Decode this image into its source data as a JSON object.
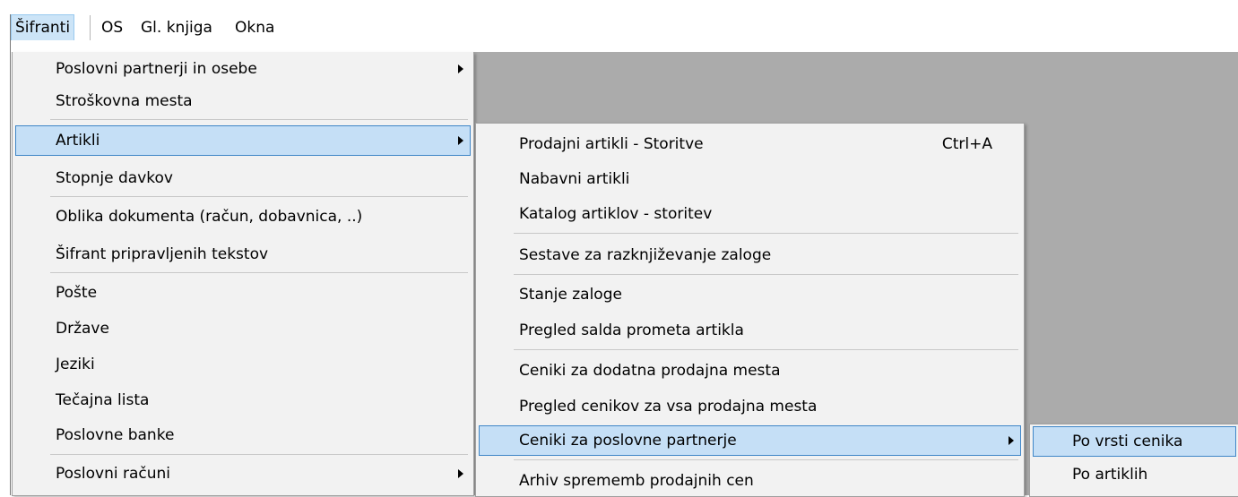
{
  "menubar": {
    "items": [
      "Šifranti",
      "OS",
      "Gl. knjiga",
      "Okna"
    ]
  },
  "menu1": {
    "items": [
      {
        "label": "Poslovni partnerji in osebe",
        "submenu": true
      },
      {
        "label": "Stroškovna mesta"
      },
      {
        "label": "Artikli",
        "submenu": true,
        "selected": true
      },
      {
        "label": "Stopnje davkov"
      },
      {
        "label": "Oblika dokumenta (račun, dobavnica, ..)"
      },
      {
        "label": "Šifrant pripravljenih tekstov"
      },
      {
        "label": "Pošte"
      },
      {
        "label": "Države"
      },
      {
        "label": "Jeziki"
      },
      {
        "label": "Tečajna lista"
      },
      {
        "label": "Poslovne banke"
      },
      {
        "label": "Poslovni računi",
        "submenu": true
      }
    ]
  },
  "menu2": {
    "items": [
      {
        "label": "Prodajni artikli - Storitve",
        "shortcut": "Ctrl+A"
      },
      {
        "label": "Nabavni artikli"
      },
      {
        "label": "Katalog artiklov - storitev"
      },
      {
        "label": "Sestave za razknjiževanje zaloge"
      },
      {
        "label": "Stanje zaloge"
      },
      {
        "label": "Pregled salda prometa artikla"
      },
      {
        "label": "Ceniki za dodatna prodajna mesta"
      },
      {
        "label": "Pregled cenikov za vsa prodajna mesta"
      },
      {
        "label": "Ceniki za poslovne partnerje",
        "submenu": true,
        "selected": true
      },
      {
        "label": "Arhiv sprememb prodajnih cen"
      }
    ]
  },
  "menu3": {
    "items": [
      {
        "label": "Po vrsti cenika",
        "selected": true
      },
      {
        "label": "Po artiklih"
      }
    ]
  }
}
